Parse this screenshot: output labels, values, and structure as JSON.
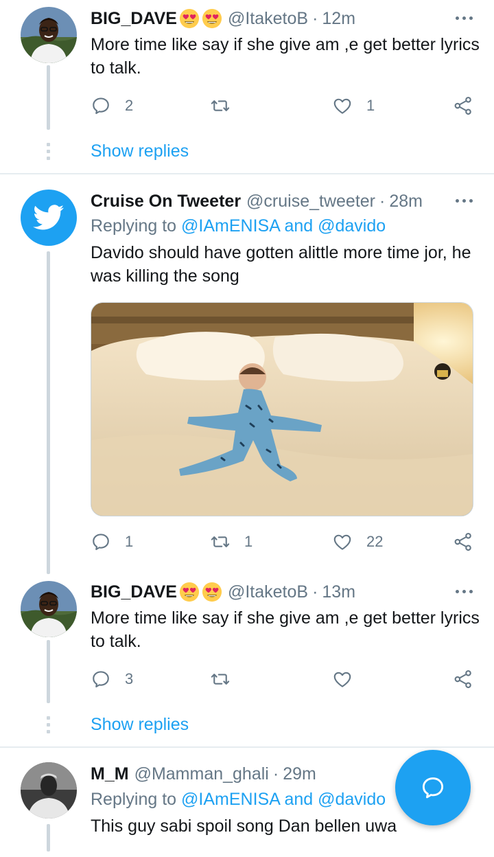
{
  "tweets": [
    {
      "name": "BIG_DAVE",
      "emojis": [
        "heart-eyes-emoji",
        "heart-eyes-emoji"
      ],
      "handle": "@ItaketoB",
      "time": "12m",
      "text": "More time like say if she give am ,e  get better lyrics to talk.",
      "replies_count": "2",
      "retweets_count": "",
      "likes_count": "1",
      "show_replies": "Show replies"
    },
    {
      "name": "Cruise On Tweeter",
      "handle": "@cruise_tweeter",
      "time": "28m",
      "replying_prefix": "Replying to",
      "replying_to": "@IAmENISA and @davido",
      "text": "Davido should have gotten alittle more time jor, he was killing the song",
      "media": "photo of a child in blue pajamas sprawled asleep on a large bed",
      "replies_count": "1",
      "retweets_count": "1",
      "likes_count": "22"
    },
    {
      "name": "BIG_DAVE",
      "emojis": [
        "heart-eyes-emoji",
        "heart-eyes-emoji"
      ],
      "handle": "@ItaketoB",
      "time": "13m",
      "text": "More time like say if she give am ,e  get better lyrics to talk.",
      "replies_count": "3",
      "retweets_count": "",
      "likes_count": "",
      "show_replies": "Show replies"
    },
    {
      "name": "M_M",
      "handle": "@Mamman_ghali",
      "time": "29m",
      "replying_prefix": "Replying to",
      "replying_to": "@IAmENISA and @davido",
      "text": "This guy sabi spoil song Dan bellen uwa"
    }
  ],
  "dot_separator": "·",
  "fab": {
    "icon": "compose-reply-icon"
  },
  "colors": {
    "accent": "#1da1f2",
    "secondary_text": "#657786",
    "thread_line": "#cdd6dd",
    "divider": "#e6ecf0"
  }
}
